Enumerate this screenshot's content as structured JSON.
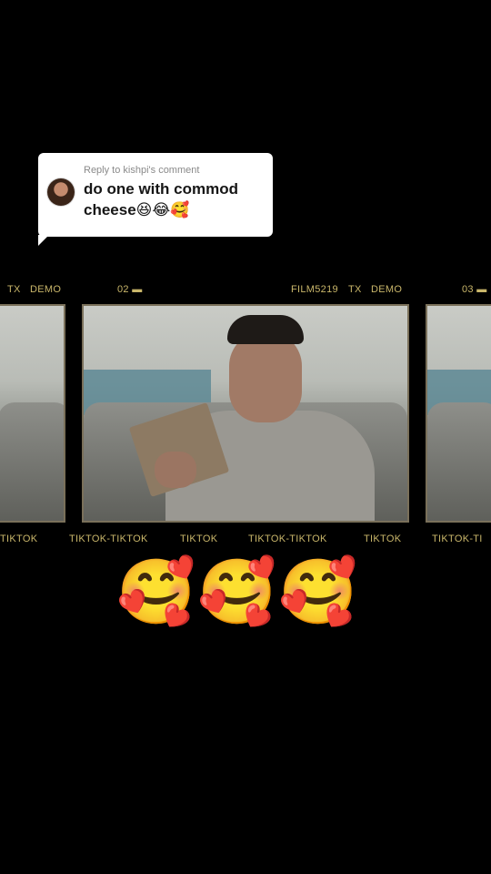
{
  "reply": {
    "header": "Reply to kishpi's comment",
    "text": "do one with commod\ncheese😆😂🥰"
  },
  "film": {
    "top_labels": [
      "TX",
      "DEMO",
      "02 ▬",
      "FILM5219",
      "TX",
      "DEMO",
      "03 ▬"
    ],
    "bottom_labels": [
      "TIKTOK",
      "TIKTOK-TIKTOK",
      "TIKTOK",
      "TIKTOK-TIKTOK",
      "TIKTOK",
      "TIKTOK-TI"
    ]
  },
  "emojis": [
    "🥰",
    "🥰",
    "🥰"
  ]
}
